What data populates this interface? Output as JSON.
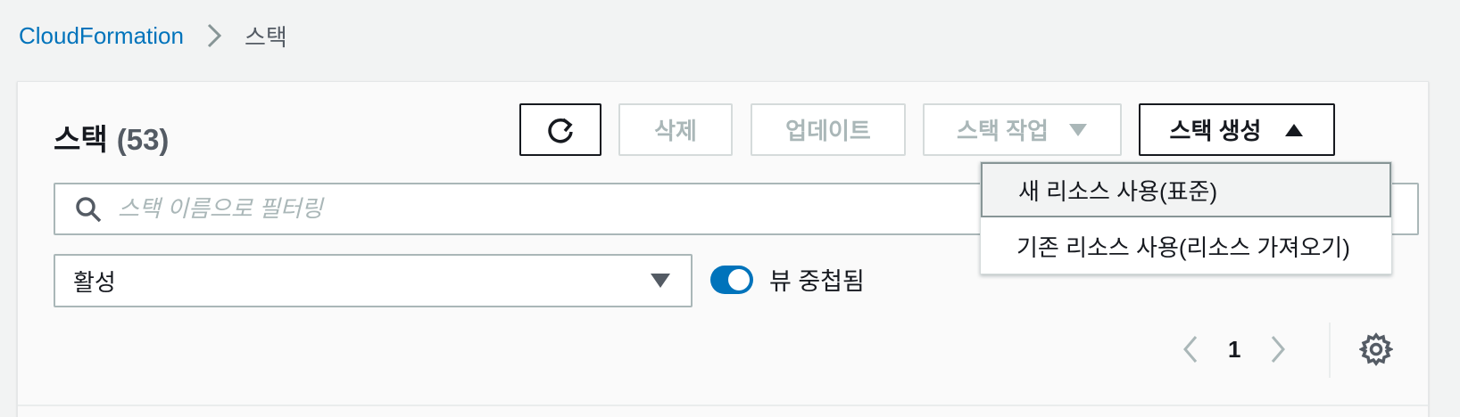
{
  "breadcrumb": {
    "root": "CloudFormation",
    "current": "스택"
  },
  "panel": {
    "title": "스택",
    "count": "(53)"
  },
  "toolbar": {
    "delete_label": "삭제",
    "update_label": "업데이트",
    "stack_actions_label": "스택 작업",
    "create_stack_label": "스택 생성"
  },
  "search": {
    "placeholder": "스택 이름으로 필터링"
  },
  "filter_select": {
    "value": "활성"
  },
  "nested_toggle": {
    "label": "뷰 중첩됨",
    "on": true
  },
  "pagination": {
    "page": "1"
  },
  "create_menu": {
    "items": [
      "새 리소스 사용(표준)",
      "기존 리소스 사용(리소스 가져오기)"
    ]
  },
  "colors": {
    "link": "#0073bb",
    "toggle_on": "#0073bb",
    "disabled_text": "#aab7b8"
  }
}
